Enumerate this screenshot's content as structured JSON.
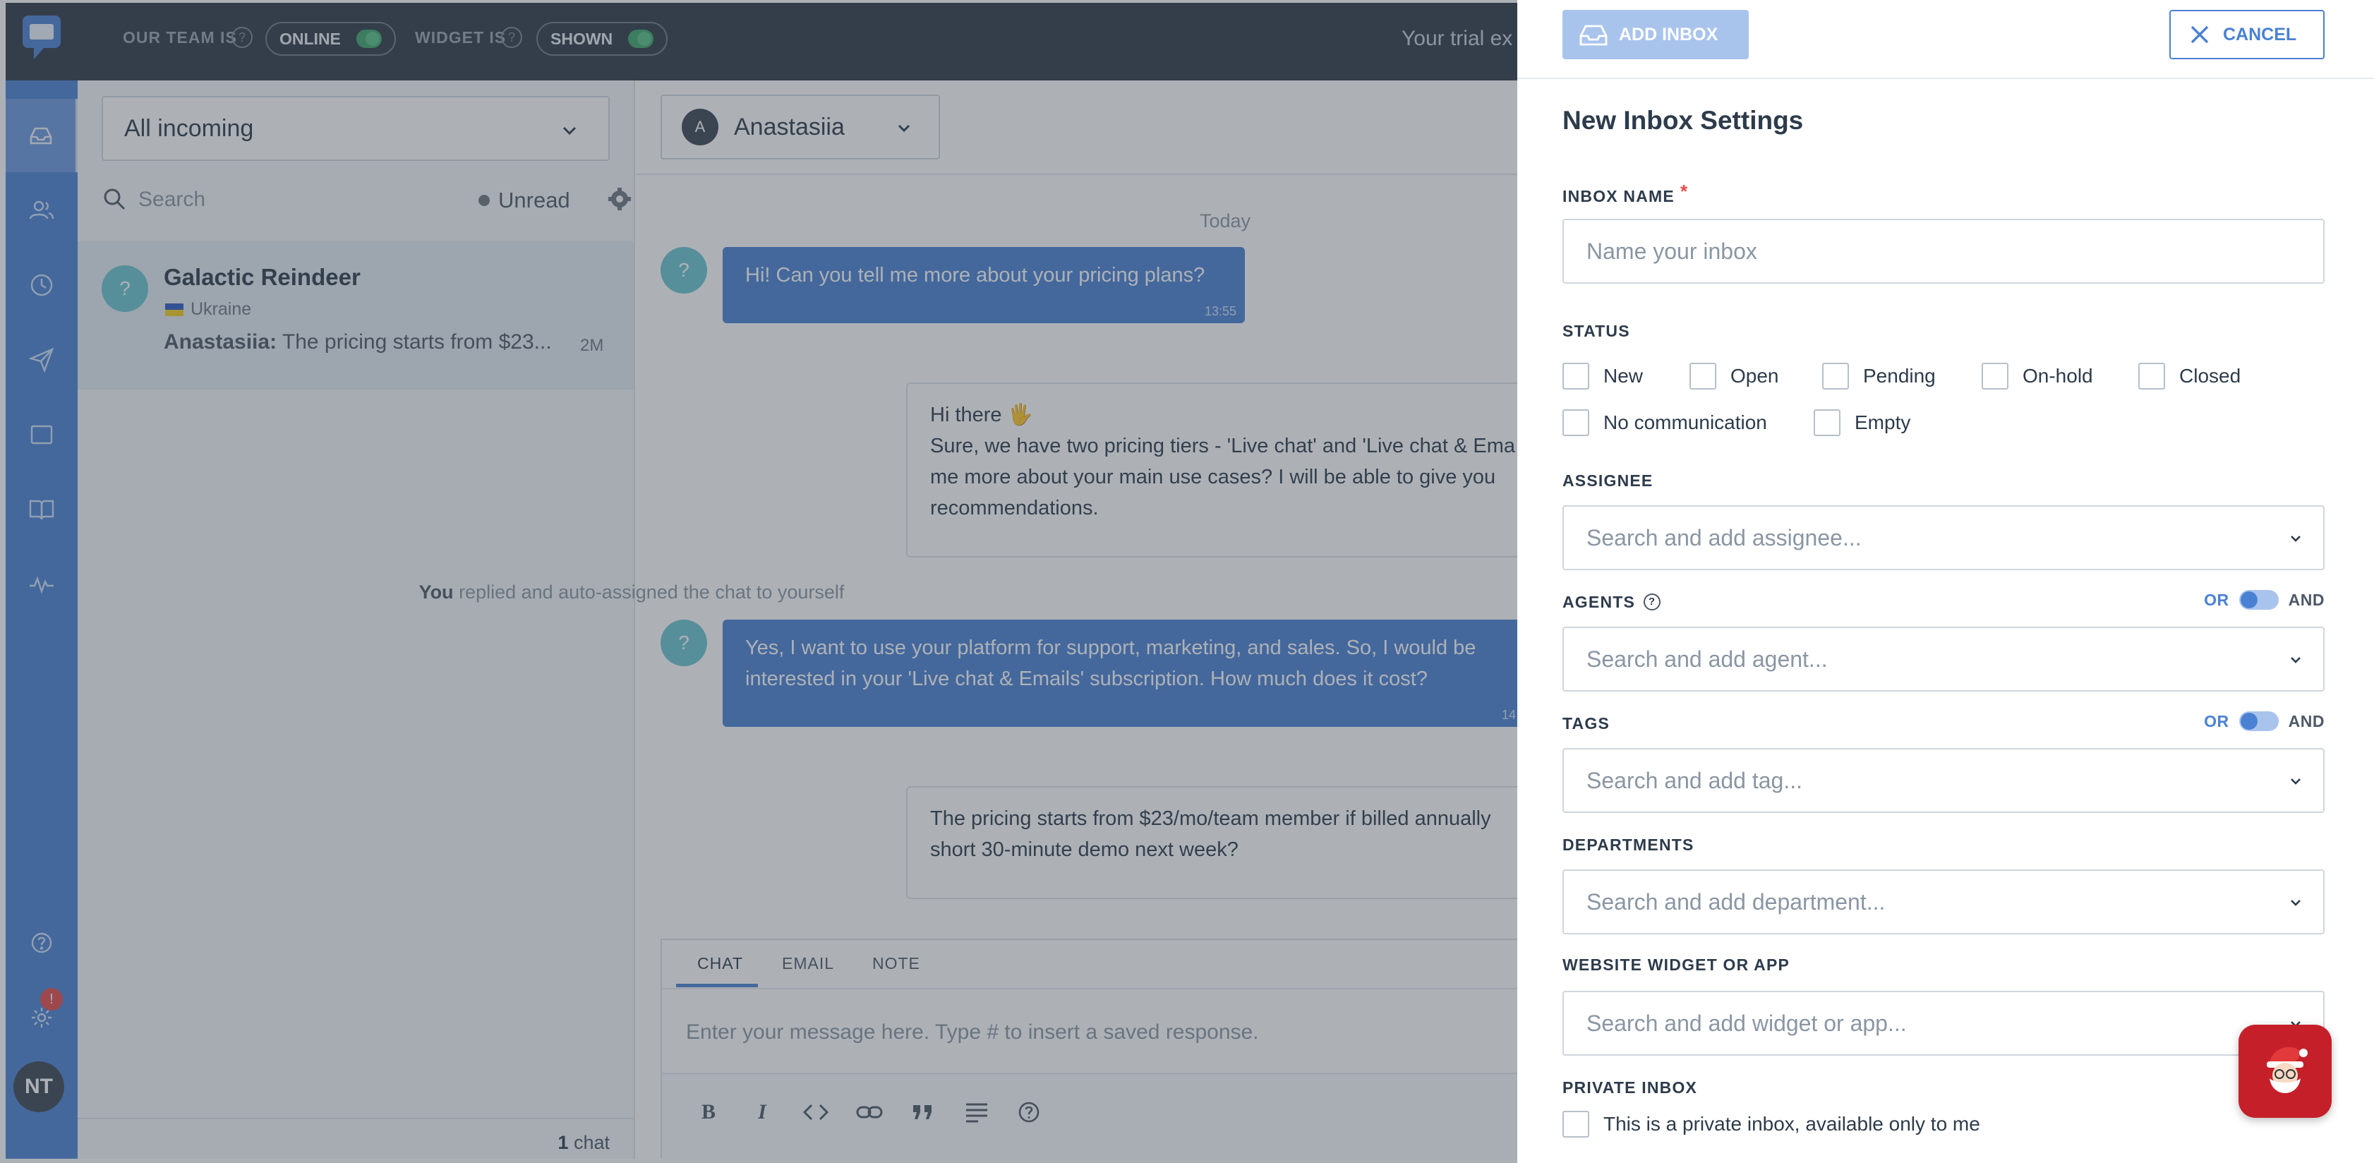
{
  "topbar": {
    "team_label": "OUR TEAM IS",
    "team_status": "ONLINE",
    "widget_label": "WIDGET IS",
    "widget_status": "SHOWN",
    "trial_text": "Your trial ex"
  },
  "rail": {
    "icons": [
      "inbox-icon",
      "contacts-icon",
      "history-icon",
      "send-icon",
      "window-icon",
      "book-icon",
      "pulse-icon"
    ],
    "settings_badge": "!",
    "avatar_initials": "NT"
  },
  "list": {
    "filter": "All incoming",
    "search_placeholder": "Search",
    "unread_label": "Unread",
    "conversation": {
      "avatar": "?",
      "name": "Galactic Reindeer",
      "country": "Ukraine",
      "preview_author": "Anastasiia:",
      "preview_text": " The pricing starts from $23...",
      "time": "2M"
    },
    "chat_count_num": "1",
    "chat_count_label": " chat"
  },
  "chat": {
    "agent_initial": "A",
    "agent_name": "Anastasiia",
    "day_label": "Today",
    "messages": [
      {
        "text": "Hi! Can you tell me more about your pricing plans?",
        "time": "13:55"
      },
      {
        "line1": "Hi there 🖐",
        "line2": "Sure, we have two pricing tiers - 'Live chat' and 'Live chat & Ema",
        "line3": "me more about your main use cases? I will be able to give you",
        "line4": "recommendations."
      },
      {
        "line1": "Yes, I want to use your platform for support, marketing, and sales. So, I would be",
        "line2": "interested in your 'Live chat & Emails' subscription. How much does it cost?",
        "time": "14"
      },
      {
        "line1": "The pricing starts from $23/mo/team member if billed annually",
        "line2": "short 30-minute demo next week?"
      }
    ],
    "system_you": "You",
    "system_text": " replied and auto-assigned the chat to yourself",
    "composer": {
      "tabs": [
        "CHAT",
        "EMAIL",
        "NOTE"
      ],
      "placeholder": "Enter your message here. Type # to insert a saved response.",
      "tools": [
        "bold-icon",
        "italic-icon",
        "code-icon",
        "link-icon",
        "quote-icon",
        "align-icon",
        "help-icon"
      ]
    }
  },
  "panel": {
    "add_inbox": "ADD INBOX",
    "cancel": "CANCEL",
    "title": "New Inbox Settings",
    "inbox_name_label": "INBOX NAME",
    "inbox_name_required": "*",
    "inbox_name_placeholder": "Name your inbox",
    "status_label": "STATUS",
    "statuses": [
      "New",
      "Open",
      "Pending",
      "On-hold",
      "Closed",
      "No communication",
      "Empty"
    ],
    "assignee_label": "ASSIGNEE",
    "assignee_placeholder": "Search and add assignee...",
    "agents_label": "AGENTS",
    "agents_placeholder": "Search and add agent...",
    "tags_label": "TAGS",
    "tags_placeholder": "Search and add tag...",
    "or_label": "OR",
    "and_label": "AND",
    "departments_label": "DEPARTMENTS",
    "departments_placeholder": "Search and add department...",
    "widget_label": "WEBSITE WIDGET OR APP",
    "widget_placeholder": "Search and add widget or app...",
    "private_label": "PRIVATE INBOX",
    "private_text": "This is a private inbox, available only to me"
  },
  "colors": {
    "accent": "#4a81d3",
    "topbar": "#2f3a48",
    "online": "#3ea66a",
    "required": "#e34a4a",
    "santa": "#c5202a"
  }
}
